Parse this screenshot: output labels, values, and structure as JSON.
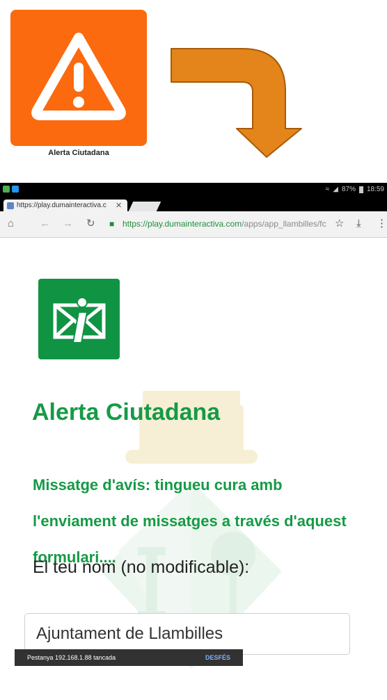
{
  "illustration": {
    "app_name": "Alerta Ciutadana",
    "tile_color": "#fb6a0e",
    "icon": "warning-triangle-icon",
    "arrow_color": "#e3851a"
  },
  "status_bar": {
    "battery": "87%",
    "time": "18:59"
  },
  "browser": {
    "tab_title": "https://play.dumainteractiva.c",
    "url_host": "https://play.dumainteractiva.com",
    "url_path": "/apps/app_llambilles/fc",
    "icons": [
      "home-icon",
      "back-icon",
      "forward-icon",
      "reload-icon",
      "lock-icon",
      "star-icon",
      "download-icon",
      "menu-icon"
    ]
  },
  "page": {
    "accent": "#169a46",
    "title": "Alerta Ciutadana",
    "warning": "Missatge d'avís: tingueu cura amb l'enviament de missatges a través d'aquest formulari....",
    "name_label": "El teu nom (no modificable):",
    "name_value": "Ajuntament de Llambilles"
  },
  "snackbar": {
    "message": "Pestanya 192.168.1.88 tancada",
    "action": "DESFÉS"
  }
}
